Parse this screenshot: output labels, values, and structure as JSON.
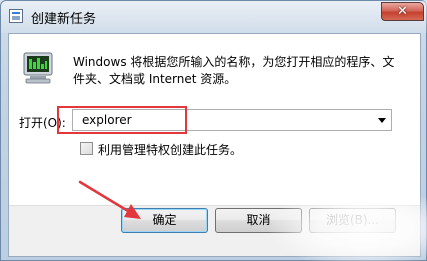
{
  "window": {
    "title": "创建新任务",
    "close_label": "✕"
  },
  "dialog": {
    "description": "Windows 将根据您所输入的名称，为您打开相应的程序、文件夹、文档或 Internet 资源。",
    "open_label": "打开(O):",
    "command_value": "explorer",
    "admin_checkbox_label": "利用管理特权创建此任务。",
    "admin_checked": false
  },
  "buttons": {
    "ok": "确定",
    "cancel": "取消",
    "browse": "浏览(B)..."
  },
  "annotation": {
    "highlight_color": "#e2373d",
    "arrow_color": "#e2373d"
  },
  "icons": {
    "title_icon": "task-manager-icon",
    "app_icon": "run-program-icon",
    "dropdown": "chevron-down-icon"
  }
}
